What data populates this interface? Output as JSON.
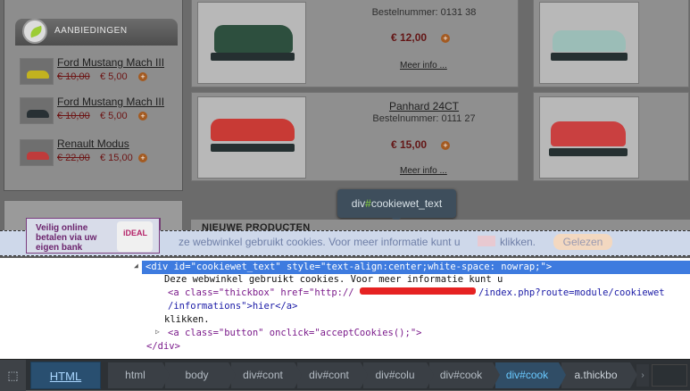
{
  "sidebar": {
    "title": "AANBIEDINGEN",
    "deals": [
      {
        "name": "Ford Mustang Mach III",
        "old_price": "€ 10,00",
        "new_price": "€ 5,00",
        "color": "#c2b21f"
      },
      {
        "name": "Ford Mustang Mach III",
        "old_price": "€ 10,00",
        "new_price": "€ 5,00",
        "color": "#283034"
      },
      {
        "name": "Renault Modus",
        "old_price": "€ 22,00",
        "new_price": "€ 15,00",
        "color": "#bf3b3b"
      }
    ],
    "ideal": {
      "text": "Veilig online betalen via uw eigen bank",
      "logo": "iDEAL"
    }
  },
  "products": [
    {
      "title": "",
      "sku": "Bestelnummer: 0131 38",
      "price": "€ 12,00",
      "more": "Meer info ...",
      "model_color": "#2d4f3e"
    },
    {
      "title": "Panhard 24CT",
      "sku": "Bestelnummer: 0111 27",
      "price": "€ 15,00",
      "more": "Meer info ...",
      "model_color": "#c83a35"
    }
  ],
  "right_products": [
    {
      "model_color": "#9bbdb7"
    },
    {
      "model_color": "#c94040"
    }
  ],
  "tooltip": {
    "prefix": "div",
    "hash": "#",
    "id": "cookiewet_text"
  },
  "new_products": "NIEUWE PRODUCTEN",
  "cookie_bar": {
    "message": "ze webwinkel gebruikt cookies. Voor meer informatie kunt u",
    "after_link": "klikken.",
    "accept": "Gelezen"
  },
  "code": {
    "line1": "<div id=\"cookiewet_text\" style=\"text-align:center;white-space: nowrap;\">",
    "line2": "Deze webwinkel gebruikt cookies. Voor meer informatie kunt u",
    "line3a": "<a class=\"thickbox\" href=\"http://",
    "line3b": "/index.php?route=module/cookiewet",
    "line4": "/informations\">hier</a>",
    "line5": "klikken.",
    "line6": "<a class=\"button\" onclick=\"acceptCookies();\">",
    "line7": "</div>"
  },
  "devtools": {
    "tool_icon": "inspect-icon",
    "tab": "HTML",
    "breadcrumbs": [
      "html",
      "body",
      "div#cont",
      "div#cont",
      "div#colu",
      "div#cook",
      "div#cook",
      "a.thickbo"
    ],
    "active_index": 6
  }
}
